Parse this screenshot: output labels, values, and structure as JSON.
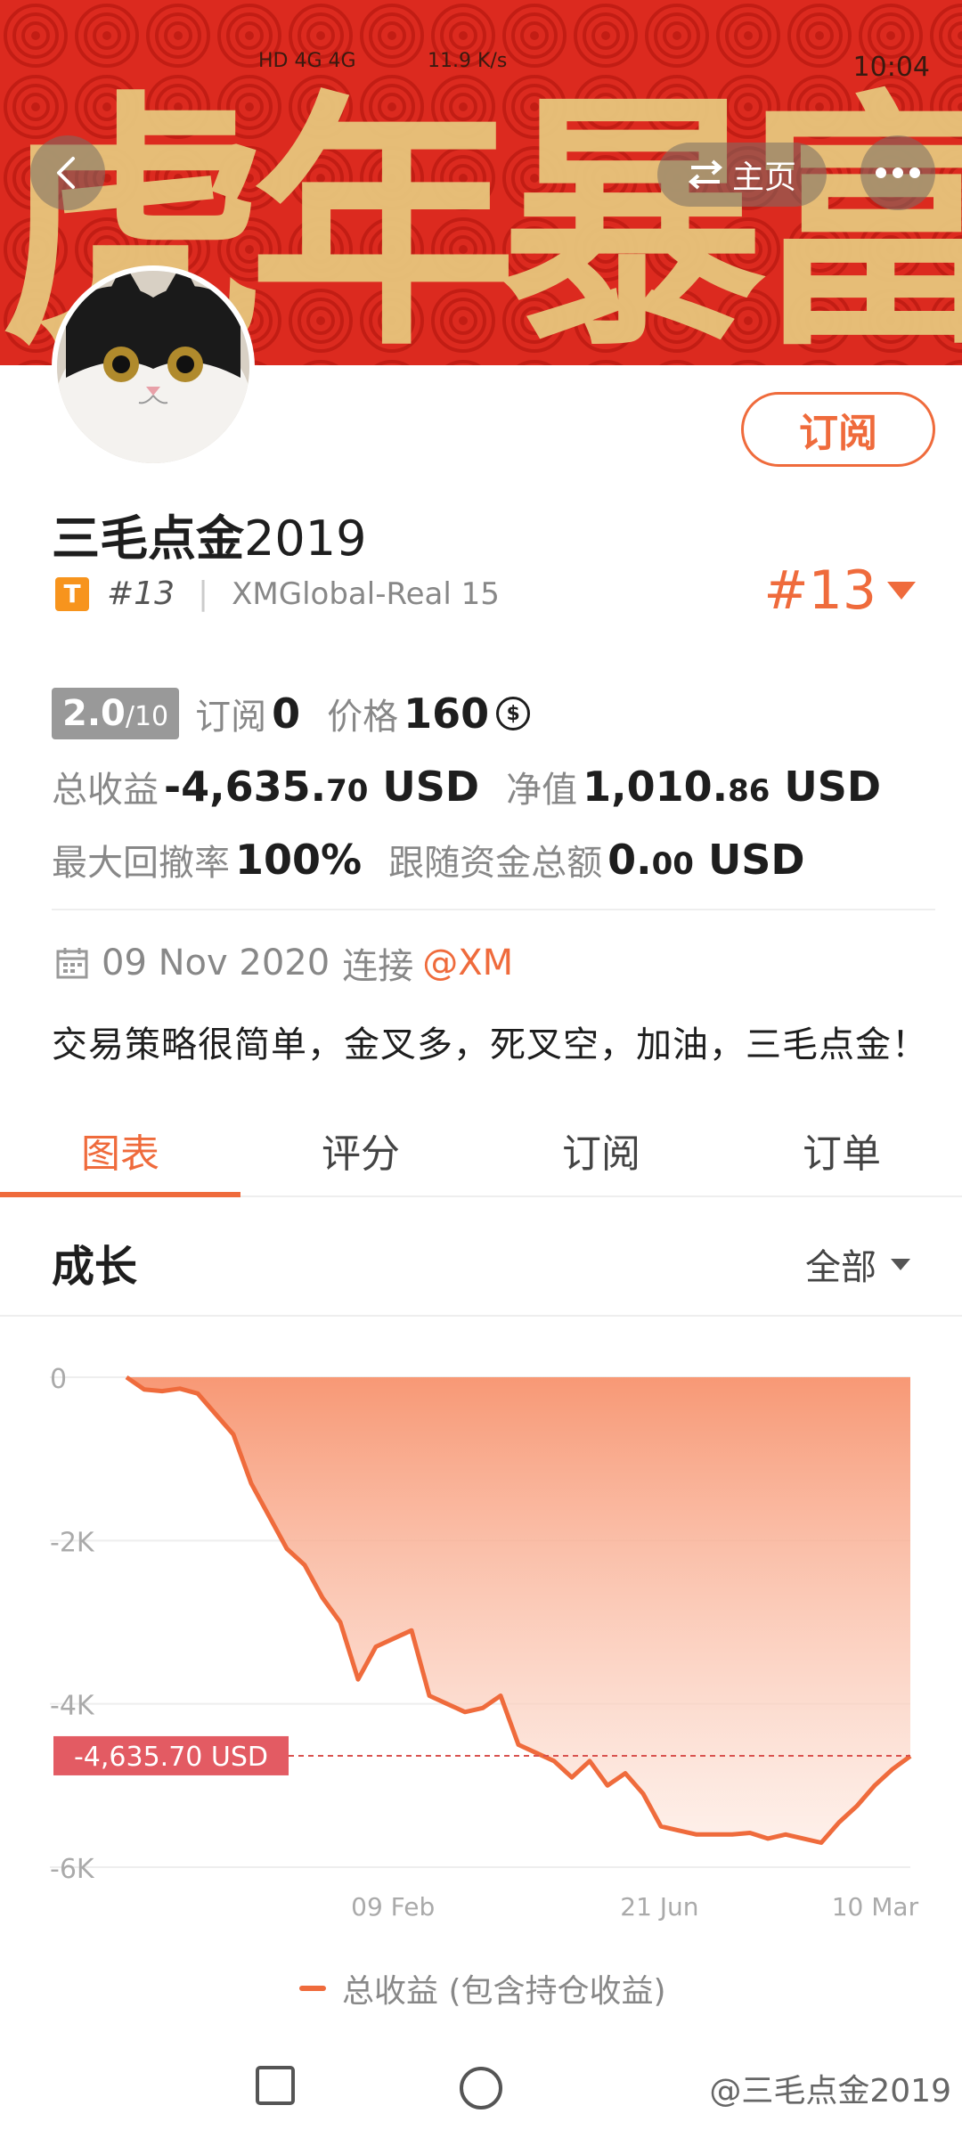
{
  "status_bar": {
    "network": "HD 4G 4G",
    "speed": "11.9 K/s",
    "time": "10:04"
  },
  "banner": {
    "calligraphy": "虎年暴富",
    "home_label": "主页"
  },
  "profile": {
    "name_cn": "三毛点金",
    "name_year": "2019",
    "badge": "T",
    "rank": "#13",
    "account": "XMGlobal-Real 15",
    "rank_big": "#13",
    "subscribe_label": "订阅"
  },
  "stats": {
    "score": "2.0",
    "score_max": "/10",
    "subscribers_label": "订阅",
    "subscribers": "0",
    "price_label": "价格",
    "price": "160",
    "total_profit_label": "总收益",
    "total_profit_int": "-4,635.",
    "total_profit_dec": "70",
    "total_profit_unit": "USD",
    "equity_label": "净值",
    "equity_int": "1,010.",
    "equity_dec": "86",
    "equity_unit": "USD",
    "max_drawdown_label": "最大回撤率",
    "max_drawdown": "100%",
    "follow_funds_label": "跟随资金总额",
    "follow_funds_int": "0.",
    "follow_funds_dec": "00",
    "follow_funds_unit": "USD"
  },
  "info": {
    "date": "09 Nov 2020",
    "connect_label": "连接",
    "broker": "@XM",
    "description": "交易策略很简单，金叉多，死叉空，加油，三毛点金！"
  },
  "tabs": [
    {
      "label": "图表",
      "active": true
    },
    {
      "label": "评分",
      "active": false
    },
    {
      "label": "订阅",
      "active": false
    },
    {
      "label": "订单",
      "active": false
    }
  ],
  "section": {
    "title": "成长",
    "range": "全部"
  },
  "chart_data": {
    "type": "area",
    "y_ticks": [
      "0",
      "-2K",
      "-4K",
      "-6K"
    ],
    "x_ticks": [
      "09 Feb",
      "21 Jun",
      "10 Mar"
    ],
    "ylim": [
      -6000,
      0
    ],
    "current_label": "-4,635.70 USD",
    "current_value": -4635.7,
    "line_color": "#ef6b3c",
    "series": [
      {
        "name": "总收益 (包含持仓收益)",
        "values": [
          0,
          -150,
          -170,
          -140,
          -200,
          -450,
          -700,
          -1300,
          -1700,
          -2100,
          -2300,
          -2700,
          -3000,
          -3700,
          -3300,
          -3200,
          -3100,
          -3900,
          -4000,
          -4100,
          -4050,
          -3900,
          -4500,
          -4600,
          -4700,
          -4900,
          -4700,
          -5000,
          -4850,
          -5100,
          -5500,
          -5550,
          -5600,
          -5600,
          -5600,
          -5580,
          -5650,
          -5600,
          -5650,
          -5700,
          -5450,
          -5250,
          -5000,
          -4800,
          -4640
        ]
      }
    ]
  },
  "legend": {
    "label": "总收益 (包含持仓收益)"
  },
  "watermark": "@三毛点金2019"
}
